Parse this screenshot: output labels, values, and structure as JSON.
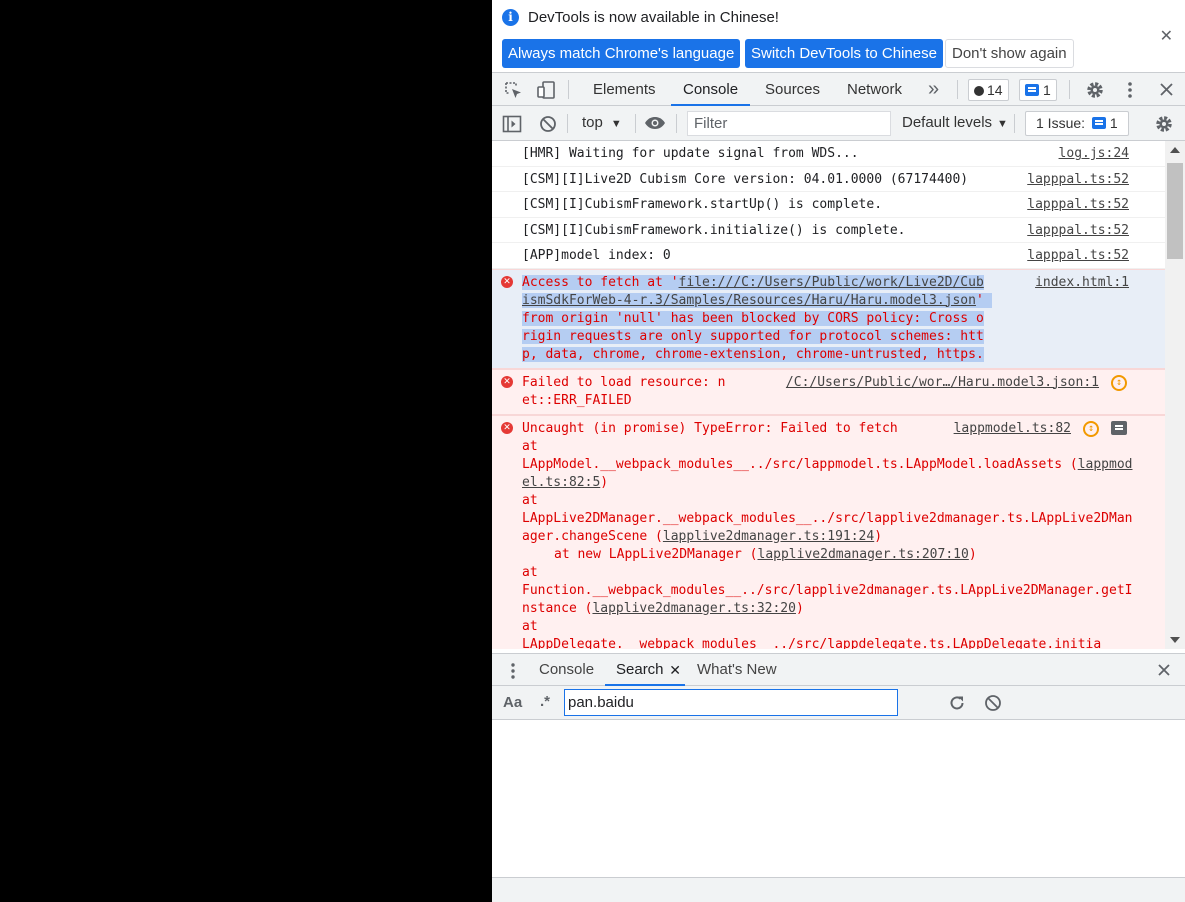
{
  "infobar": {
    "message": "DevTools is now available in Chinese!",
    "buttons": {
      "match_language": "Always match Chrome's language",
      "switch_chinese": "Switch DevTools to Chinese",
      "dont_show": "Don't show again"
    },
    "close_glyph": "✕"
  },
  "main_tabs": {
    "tabs": [
      "Elements",
      "Console",
      "Sources",
      "Network"
    ],
    "active": "Console",
    "more_glyph": "»",
    "error_count": "14",
    "message_count": "1"
  },
  "console_toolbar": {
    "context": "top",
    "filter_placeholder": "Filter",
    "levels": "Default levels",
    "issues_label": "1 Issue:",
    "issues_count": "1"
  },
  "messages": [
    {
      "type": "log",
      "text": "[HMR] Waiting for update signal from WDS...",
      "source": "log.js:24"
    },
    {
      "type": "log",
      "text": "[CSM][I]Live2D Cubism Core version: 04.01.0000 (67174400)",
      "source": "lapppal.ts:52"
    },
    {
      "type": "log",
      "text": "[CSM][I]CubismFramework.startUp() is complete.",
      "source": "lapppal.ts:52"
    },
    {
      "type": "log",
      "text": "[CSM][I]CubismFramework.initialize() is complete.",
      "source": "lapppal.ts:52"
    },
    {
      "type": "log",
      "text": "[APP]model index: 0",
      "source": "lapppal.ts:52"
    }
  ],
  "cors_error": {
    "prefix": "Access to fetch at '",
    "url": "file:///C:/Users/Public/work/Live2D/CubismSdkForWeb-4-r.3/Samples/Resources/Haru/Haru.model3.json",
    "suffix": "' from origin 'null' has been blocked by CORS policy: Cross origin requests are only supported for protocol schemes: http, data, chrome, chrome-extension, chrome-untrusted, https.",
    "source": "index.html:1"
  },
  "load_error": {
    "text": "Failed to load resource: net::ERR_FAILED",
    "source": "/C:/Users/Public/wor…/Haru.model3.json:1"
  },
  "uncaught_error": {
    "headline": "Uncaught (in promise) TypeError: Failed to fetch",
    "source": "lappmodel.ts:82",
    "stack": [
      {
        "at": "at",
        "fn": "LAppModel.__webpack_modules__../src/lappmodel.ts.LAppModel.loadAssets",
        "loc": "lappmodel.ts:82:5"
      },
      {
        "at": "at",
        "fn": "LAppLive2DManager.__webpack_modules__../src/lapplive2dmanager.ts.LAppLive2DManager.changeScene",
        "loc": "lapplive2dmanager.ts:191:24"
      },
      {
        "at": "at new LAppLive2DManager",
        "fn": "",
        "loc": "lapplive2dmanager.ts:207:10"
      },
      {
        "at": "at",
        "fn": "Function.__webpack_modules__../src/lapplive2dmanager.ts.LAppLive2DManager.getInstance",
        "loc": "lapplive2dmanager.ts:32:20"
      },
      {
        "at": "at",
        "fn": "LAppDelegate.__webpack_modules__../src/lappdelegate.ts.LAppDelegate.initia",
        "loc": ""
      }
    ]
  },
  "drawer": {
    "tabs": [
      "Console",
      "Search",
      "What's New"
    ],
    "active": "Search",
    "close_glyph": "✕",
    "case_label": "Aa",
    "regex_label": ".*",
    "search_value": "pan.baidu"
  },
  "colors": {
    "accent": "#1a73e8",
    "error_text": "#dd0000",
    "error_bg": "#fff0f0",
    "selection": "#b5cdf2"
  }
}
